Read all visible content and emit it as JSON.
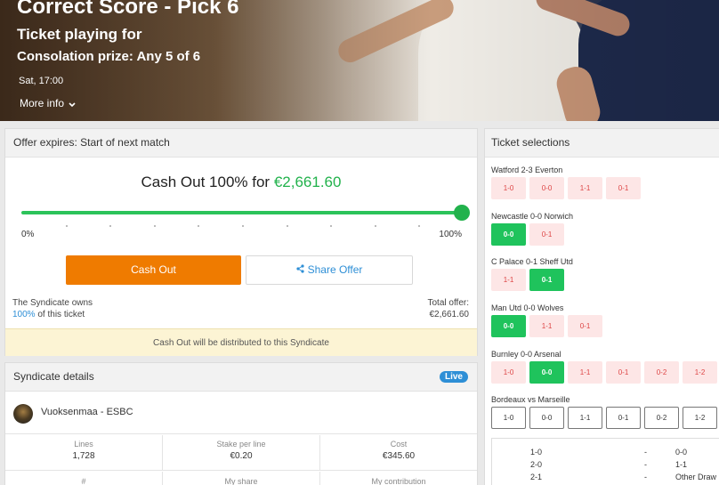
{
  "hero": {
    "title": "Correct Score - Pick 6",
    "subtitle": "Ticket playing for",
    "consolation": "Consolation prize:  Any 5 of 6",
    "time": "Sat, 17:00",
    "more_info": "More info"
  },
  "offer": {
    "expires": "Offer expires: Start of next match",
    "cash_prefix": "Cash Out 100% for ",
    "cash_amount": "€2,661.60",
    "slider_percent": 100,
    "min_label": "0%",
    "max_label": "100%",
    "cash_out_button": "Cash Out",
    "share_button": "Share Offer",
    "owns_line1": "The Syndicate owns",
    "owns_pct": "100%",
    "owns_line2": " of this ticket",
    "total_label": "Total offer:",
    "total_value": "€2,661.60",
    "notice": "Cash Out will be distributed to this Syndicate",
    "colors": {
      "accent_green": "#22b24c",
      "cash_orange": "#ef7b00",
      "link_blue": "#2e8fd6"
    }
  },
  "syndicate": {
    "header": "Syndicate details",
    "live": "Live",
    "name": "Vuoksenmaa - ESBC",
    "stats": [
      {
        "label": "Lines",
        "value": "1,728"
      },
      {
        "label": "Stake per line",
        "value": "€0.20"
      },
      {
        "label": "Cost",
        "value": "€345.60"
      }
    ],
    "stats2": [
      "#",
      "My share",
      "My contribution"
    ]
  },
  "selections": {
    "header": "Ticket selections",
    "matches": [
      {
        "name": "Watford 2-3 Everton",
        "chips": [
          {
            "t": "1-0",
            "s": "red"
          },
          {
            "t": "0-0",
            "s": "red"
          },
          {
            "t": "1-1",
            "s": "red"
          },
          {
            "t": "0-1",
            "s": "red"
          }
        ]
      },
      {
        "name": "Newcastle 0-0 Norwich",
        "chips": [
          {
            "t": "0-0",
            "s": "green"
          },
          {
            "t": "0-1",
            "s": "red"
          }
        ]
      },
      {
        "name": "C Palace 0-1 Sheff Utd",
        "chips": [
          {
            "t": "1-1",
            "s": "red"
          },
          {
            "t": "0-1",
            "s": "green"
          }
        ]
      },
      {
        "name": "Man Utd 0-0 Wolves",
        "chips": [
          {
            "t": "0-0",
            "s": "green"
          },
          {
            "t": "1-1",
            "s": "red"
          },
          {
            "t": "0-1",
            "s": "red"
          }
        ]
      },
      {
        "name": "Burnley 0-0 Arsenal",
        "chips": [
          {
            "t": "1-0",
            "s": "red"
          },
          {
            "t": "0-0",
            "s": "green"
          },
          {
            "t": "1-1",
            "s": "red"
          },
          {
            "t": "0-1",
            "s": "red"
          },
          {
            "t": "0-2",
            "s": "red"
          },
          {
            "t": "1-2",
            "s": "red"
          }
        ]
      },
      {
        "name": "Bordeaux vs Marseille",
        "chips": [
          {
            "t": "1-0",
            "s": "white"
          },
          {
            "t": "0-0",
            "s": "white"
          },
          {
            "t": "1-1",
            "s": "white"
          },
          {
            "t": "0-1",
            "s": "white"
          },
          {
            "t": "0-2",
            "s": "white"
          },
          {
            "t": "1-2",
            "s": "white"
          }
        ]
      }
    ],
    "table": [
      {
        "a": "1-0",
        "sep": "-",
        "b": "0-0"
      },
      {
        "a": "2-0",
        "sep": "-",
        "b": "1-1"
      },
      {
        "a": "2-1",
        "sep": "-",
        "b": "Other Draw"
      }
    ]
  }
}
